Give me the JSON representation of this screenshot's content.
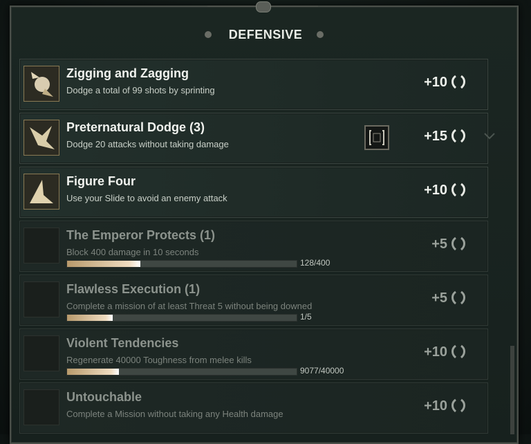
{
  "header": {
    "title": "DEFENSIVE"
  },
  "rows": [
    {
      "title": "Zigging and Zagging",
      "desc": "Dodge a total of 99 shots by sprinting",
      "reward": "+10",
      "locked": false,
      "icon": "dodging-figure-icon"
    },
    {
      "title": "Preternatural Dodge (3)",
      "desc": "Dodge 20 attacks without taking damage",
      "reward": "+15",
      "locked": false,
      "icon": "dodging-bird-icon",
      "badge": "bracket-icon",
      "expandable": true
    },
    {
      "title": "Figure Four",
      "desc": "Use your Slide to avoid an enemy attack",
      "reward": "+10",
      "locked": false,
      "icon": "slide-figure-icon"
    },
    {
      "title": "The Emperor Protects (1)",
      "desc": "Block 400 damage in 10 seconds",
      "reward": "+5",
      "locked": true,
      "progress": {
        "text": "128/400",
        "fraction": 0.32
      }
    },
    {
      "title": "Flawless Execution (1)",
      "desc": "Complete a mission of at least Threat 5 without being downed",
      "reward": "+5",
      "locked": true,
      "progress": {
        "text": "1/5",
        "fraction": 0.2
      }
    },
    {
      "title": "Violent Tendencies",
      "desc": "Regenerate 40000 Toughness from melee kills",
      "reward": "+10",
      "locked": true,
      "progress": {
        "text": "9077/40000",
        "fraction": 0.227
      }
    },
    {
      "title": "Untouchable",
      "desc": "Complete a Mission without taking any Health damage",
      "reward": "+10",
      "locked": true
    }
  ],
  "colors": {
    "accent": "#efdcc0",
    "panel": "#1b2622"
  }
}
